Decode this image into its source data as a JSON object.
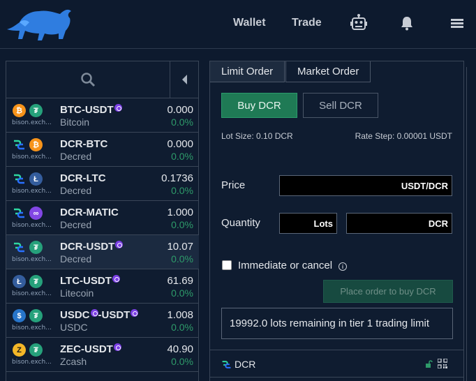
{
  "header": {
    "nav": [
      {
        "label": "Wallet"
      },
      {
        "label": "Trade"
      }
    ],
    "icons": [
      "bison-logo",
      "robot-icon",
      "bell-icon",
      "hamburger-menu-icon"
    ]
  },
  "markets": {
    "rows": [
      {
        "base_icon": "btc-icon",
        "quote_icon": "usdt-icon",
        "host": "bison.exch...",
        "pair": "BTC-USDT",
        "token_mark": true,
        "name": "Bitcoin",
        "price": "0.000",
        "change": "0.0%"
      },
      {
        "base_icon": "dcr-icon",
        "quote_icon": "btc-icon",
        "host": "bison.exch...",
        "pair": "DCR-BTC",
        "token_mark": false,
        "name": "Decred",
        "price": "0.000",
        "change": "0.0%"
      },
      {
        "base_icon": "dcr-icon",
        "quote_icon": "ltc-icon",
        "host": "bison.exch...",
        "pair": "DCR-LTC",
        "token_mark": false,
        "name": "Decred",
        "price": "0.1736",
        "change": "0.0%"
      },
      {
        "base_icon": "dcr-icon",
        "quote_icon": "matic-icon",
        "host": "bison.exch...",
        "pair": "DCR-MATIC",
        "token_mark": false,
        "name": "Decred",
        "price": "1.000",
        "change": "0.0%"
      },
      {
        "base_icon": "dcr-icon",
        "quote_icon": "usdt-icon",
        "host": "bison.exch...",
        "pair": "DCR-USDT",
        "token_mark": true,
        "name": "Decred",
        "price": "10.07",
        "change": "0.0%",
        "selected": true
      },
      {
        "base_icon": "ltc-icon",
        "quote_icon": "usdt-icon",
        "host": "bison.exch...",
        "pair": "LTC-USDT",
        "token_mark": true,
        "name": "Litecoin",
        "price": "61.69",
        "change": "0.0%"
      },
      {
        "base_icon": "usdc-icon",
        "quote_icon": "usdt-icon",
        "host": "bison.exch...",
        "pair_a": "USDC",
        "pair_b": "-USDT",
        "name": "USDC",
        "price": "1.008",
        "change": "0.0%"
      },
      {
        "base_icon": "zec-icon",
        "quote_icon": "usdt-icon",
        "host": "bison.exch...",
        "pair": "ZEC-USDT",
        "token_mark": true,
        "name": "Zcash",
        "price": "40.90",
        "change": "0.0%"
      }
    ]
  },
  "order": {
    "tabs": [
      "Limit Order",
      "Market Order"
    ],
    "buy_label": "Buy DCR",
    "sell_label": "Sell DCR",
    "lot_size": "Lot Size: 0.10 DCR",
    "rate_step": "Rate Step: 0.00001 USDT",
    "price_label": "Price",
    "price_unit": "USDT/DCR",
    "quantity_label": "Quantity",
    "lots_unit": "Lots",
    "qty_unit": "DCR",
    "ioc_label": "Immediate or cancel",
    "place_label": "Place order to buy DCR",
    "tier_limit": "19992.0 lots remaining in tier 1 trading limit",
    "wallet_coin": "DCR"
  },
  "colors": {
    "background": "#0d1a2e",
    "buy_green": "#1f7a55",
    "positive_change": "#2e9b6a",
    "token_purple": "#7b3fe4"
  }
}
